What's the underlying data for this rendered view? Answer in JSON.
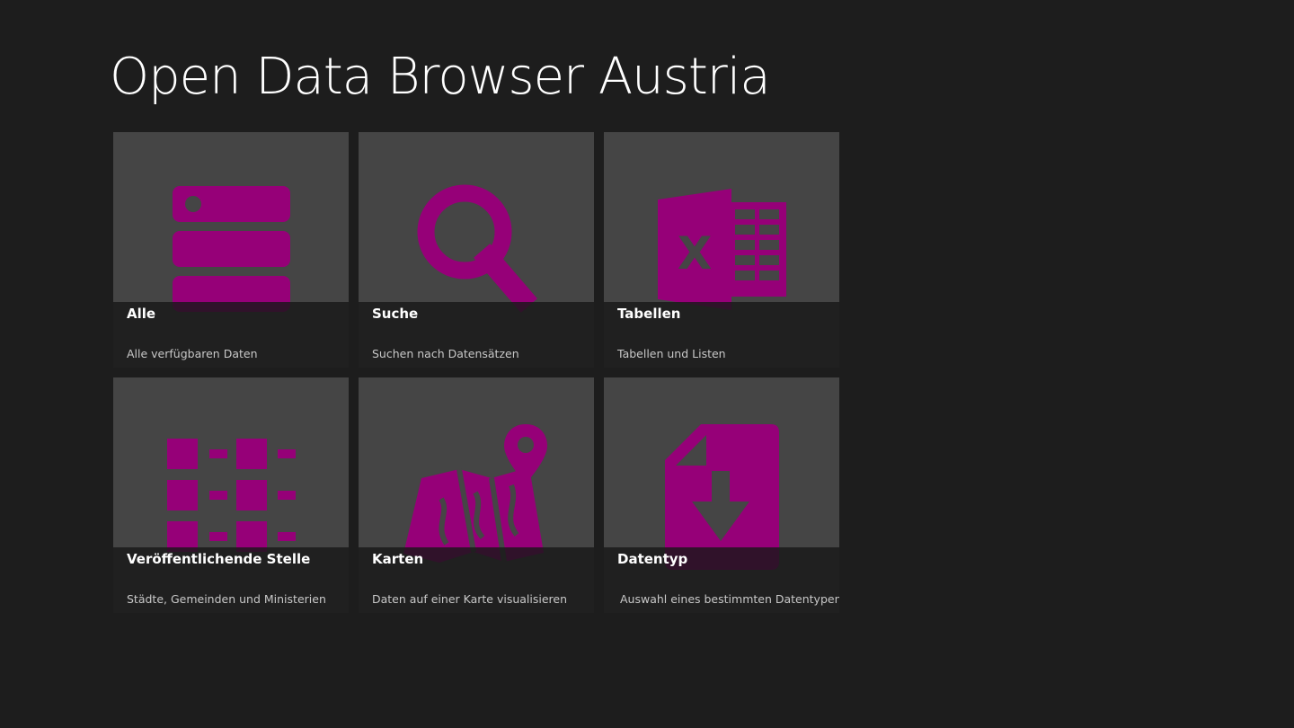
{
  "app": {
    "title": "Open Data Browser Austria"
  },
  "colors": {
    "background": "#1d1d1d",
    "tile": "#454545",
    "accent": "#960078",
    "title_text": "#ffffff",
    "subtitle_text": "#c8c8c8"
  },
  "tiles": [
    {
      "title": "Alle",
      "subtitle": "Alle verfügbaren Daten",
      "icon": "server-stack-icon"
    },
    {
      "title": "Suche",
      "subtitle": "Suchen nach Datensätzen",
      "icon": "magnifier-icon"
    },
    {
      "title": "Tabellen",
      "subtitle": "Tabellen und Listen",
      "icon": "excel-icon"
    },
    {
      "title": "Veröffentlichende Stelle",
      "subtitle": "Städte, Gemeinden und Ministerien",
      "icon": "list-grid-icon"
    },
    {
      "title": "Karten",
      "subtitle": "Daten auf einer Karte visualisieren",
      "icon": "map-pin-icon"
    },
    {
      "title": "Datentyp",
      "subtitle": "Auswahl eines bestimmten Datentypen",
      "icon": "file-download-icon"
    }
  ]
}
